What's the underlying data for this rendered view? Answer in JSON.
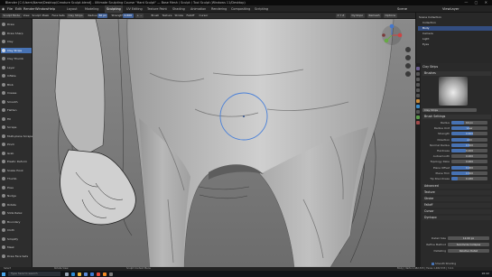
{
  "window": {
    "title": "Blender [C:\\Users\\Name\\Desktop\\Creature Sculpt.blend] - Ultimate Sculpting Course \"Hard Sculpt\" — Base Mesh / Sculpt / Tool Sculpt (Windows 11/Desktop)",
    "controls": "— ▢ ✕"
  },
  "menu": {
    "items": [
      "File",
      "Edit",
      "Render",
      "Window",
      "Help"
    ],
    "workspaces": [
      "Layout",
      "Modeling",
      "Sculpting",
      "UV Editing",
      "Texture Paint",
      "Shading",
      "Animation",
      "Rendering",
      "Compositing",
      "Scripting"
    ],
    "active_workspace": "Sculpting",
    "scene": "Scene",
    "view_layer": "ViewLayer"
  },
  "header": {
    "mode": "Sculpt Mode",
    "menus": [
      "View",
      "Sculpt",
      "Mask",
      "Face Sets"
    ],
    "brush": "Clay Strips",
    "radius_label": "Radius",
    "radius_value": "60 px",
    "strength_label": "Strength",
    "strength_value": "0.600",
    "direction": "+ −",
    "brush_menu": "Brush",
    "texture_menu": "Texture",
    "stroke_menu": "Stroke",
    "falloff_menu": "Falloff",
    "cursor_menu": "Cursor",
    "symmetry": "X Y Z",
    "dyntopo": "Dyntopo",
    "remesh": "Remesh",
    "options": "Options"
  },
  "toolbar": {
    "tools": [
      {
        "label": "Draw",
        "color": "#8a8a8a"
      },
      {
        "label": "Draw Sharp",
        "color": "#8a8a8a"
      },
      {
        "label": "Clay",
        "color": "#8a8a8a"
      },
      {
        "label": "Clay Strips",
        "color": "#cfd8e6"
      },
      {
        "label": "Clay Thumb",
        "color": "#8a8a8a"
      },
      {
        "label": "Layer",
        "color": "#8a8a8a"
      },
      {
        "label": "Inflate",
        "color": "#8a8a8a"
      },
      {
        "label": "Blob",
        "color": "#8a8a8a"
      },
      {
        "label": "Crease",
        "color": "#8a8a8a"
      },
      {
        "label": "Smooth",
        "color": "#8a8a8a"
      },
      {
        "label": "Flatten",
        "color": "#8a8a8a"
      },
      {
        "label": "Fill",
        "color": "#8a8a8a"
      },
      {
        "label": "Scrape",
        "color": "#8a8a8a"
      },
      {
        "label": "Multi-plane Scrape",
        "color": "#8a8a8a"
      },
      {
        "label": "Pinch",
        "color": "#8a8a8a"
      },
      {
        "label": "Grab",
        "color": "#8a8a8a"
      },
      {
        "label": "Elastic Deform",
        "color": "#8a8a8a"
      },
      {
        "label": "Snake Hook",
        "color": "#8a8a8a"
      },
      {
        "label": "Thumb",
        "color": "#8a8a8a"
      },
      {
        "label": "Pose",
        "color": "#8a8a8a"
      },
      {
        "label": "Nudge",
        "color": "#8a8a8a"
      },
      {
        "label": "Rotate",
        "color": "#8a8a8a"
      },
      {
        "label": "Slide Relax",
        "color": "#8a8a8a"
      },
      {
        "label": "Boundary",
        "color": "#8a8a8a"
      },
      {
        "label": "Cloth",
        "color": "#8a8a8a"
      },
      {
        "label": "Simplify",
        "color": "#8a8a8a"
      },
      {
        "label": "Mask",
        "color": "#8a8a8a"
      },
      {
        "label": "Draw Face Sets",
        "color": "#8a8a8a"
      }
    ],
    "active_tool": "Clay Strips"
  },
  "outliner": {
    "title": "Scene Collection",
    "rows": [
      {
        "label": "Scene Collection",
        "selected": false
      },
      {
        "label": "Collection",
        "selected": false
      },
      {
        "label": "Body",
        "selected": true
      },
      {
        "label": "Camera",
        "selected": false
      },
      {
        "label": "Light",
        "selected": false
      },
      {
        "label": "Eyes",
        "selected": false
      }
    ]
  },
  "properties": {
    "active_tool_label": "Clay Strips",
    "brushes_header": "Brushes",
    "brush_name": "Clay Strips",
    "brush_settings_header": "Brush Settings",
    "fields": [
      {
        "label": "Radius",
        "value": "60 px",
        "fill": 0.35
      },
      {
        "label": "Radius Unit",
        "value": "View",
        "fill": 0.5
      },
      {
        "label": "Strength",
        "value": "0.600",
        "fill": 0.6
      },
      {
        "label": "Direction",
        "value": "Add",
        "fill": 0.5
      },
      {
        "label": "Normal Radius",
        "value": "0.500",
        "fill": 0.5
      },
      {
        "label": "Hardness",
        "value": "0.400",
        "fill": 0.4
      },
      {
        "label": "Autosmooth",
        "value": "0.000",
        "fill": 0.0
      },
      {
        "label": "Topology Rake",
        "value": "0.000",
        "fill": 0.0
      },
      {
        "label": "Plane Offset",
        "value": "0.000",
        "fill": 0.5
      },
      {
        "label": "Plane Trim",
        "value": "0.500",
        "fill": 0.5
      },
      {
        "label": "Tip Roundness",
        "value": "0.180",
        "fill": 0.18
      }
    ],
    "sections": [
      "Advanced",
      "Texture",
      "Stroke",
      "Falloff",
      "Cursor",
      "Dyntopo"
    ],
    "dyntopo_fields": [
      {
        "label": "Detail Size",
        "value": "12.00 px"
      },
      {
        "label": "Refine Method",
        "value": "Subdivide Collapse"
      },
      {
        "label": "Detailing",
        "value": "Relative Detail"
      }
    ],
    "smooth_shading_label": "Smooth Shading"
  },
  "status": {
    "select": "Select",
    "rotate_view": "Rotate View",
    "context_menu": "Sculpt Context Menu",
    "stats": "Body | Verts 1,482,533 | Faces 1,482,533 | 3.4.1"
  },
  "taskbar": {
    "search_placeholder": "Type here to search",
    "time": "16:42",
    "icons": [
      {
        "name": "task-view-icon",
        "color": "#9aa6b6"
      },
      {
        "name": "edge-icon",
        "color": "#2e8bd6"
      },
      {
        "name": "explorer-icon",
        "color": "#e9b53c"
      },
      {
        "name": "store-icon",
        "color": "#5d8ad8"
      },
      {
        "name": "mail-icon",
        "color": "#3b7bd4"
      },
      {
        "name": "chrome-icon",
        "color": "#e24b3b"
      },
      {
        "name": "blender-icon",
        "color": "#f08a24"
      },
      {
        "name": "media-icon",
        "color": "#7a7a7a"
      }
    ]
  },
  "colors": {
    "accent": "#4772b3",
    "selection": "#334d80",
    "clay": "#b9b9b9",
    "brush_cursor": "#4a80d8"
  }
}
